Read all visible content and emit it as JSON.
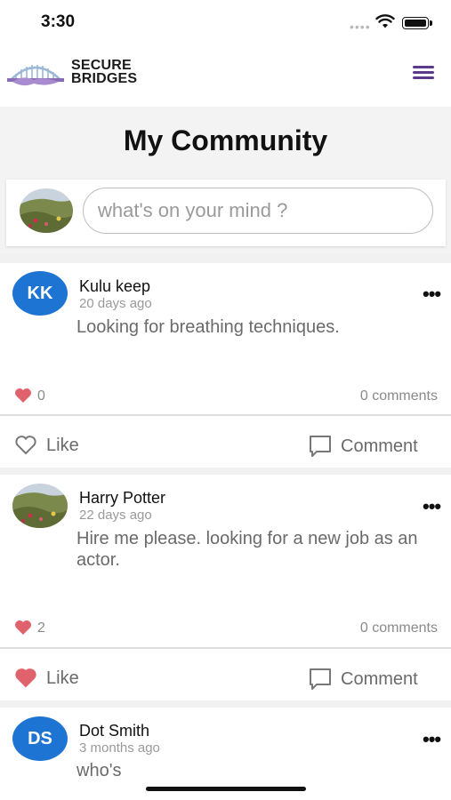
{
  "status": {
    "time": "3:30",
    "dots": "••••"
  },
  "header": {
    "brand_line1": "SECURE",
    "brand_line2": "BRIDGES"
  },
  "page": {
    "title": "My Community"
  },
  "composer": {
    "placeholder": "what's on your mind ?"
  },
  "colors": {
    "accent": "#1e74d2",
    "like": "#e0626c",
    "menu": "#5b3a8c"
  },
  "posts": [
    {
      "initials": "KK",
      "author": "Kulu keep",
      "time": "20 days ago",
      "text": "Looking for breathing techniques.",
      "likes": "0",
      "comments": "0 comments",
      "liked": false,
      "like_label": "Like",
      "comment_label": "Comment"
    },
    {
      "initials": "",
      "author": "Harry Potter",
      "time": "22 days ago",
      "text": "Hire me please. looking for a new job as an actor.",
      "likes": "2",
      "comments": "0 comments",
      "liked": true,
      "like_label": "Like",
      "comment_label": "Comment"
    },
    {
      "initials": "DS",
      "author": "Dot Smith",
      "time": "3 months ago",
      "text": "who's"
    }
  ]
}
